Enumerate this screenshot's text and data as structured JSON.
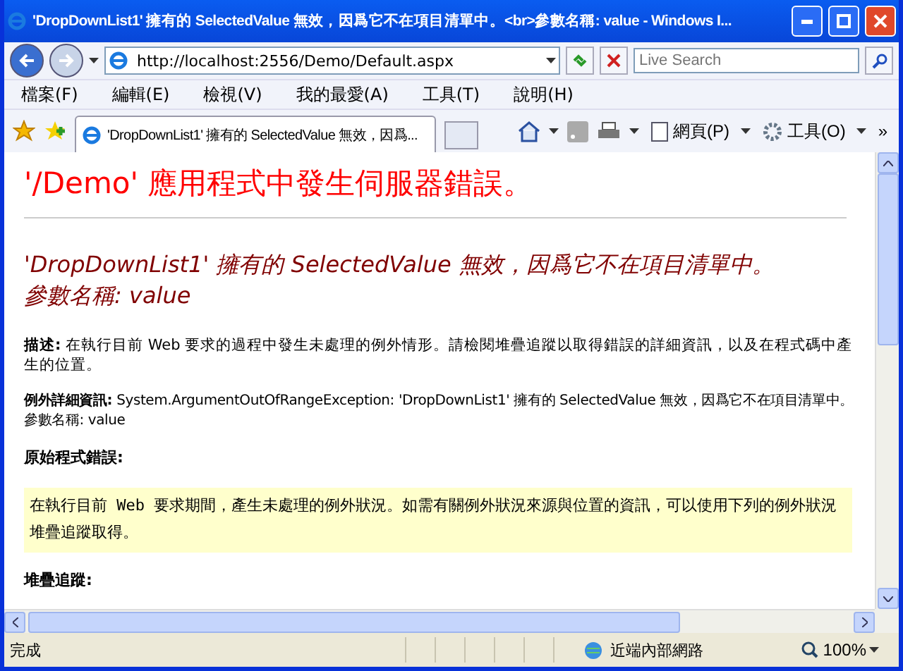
{
  "window": {
    "title": "'DropDownList1' 擁有的 SelectedValue 無效，因爲它不在項目清單中。<br>參數名稱: value - Windows I..."
  },
  "address_bar": {
    "value": "http://localhost:2556/Demo/Default.aspx"
  },
  "search": {
    "placeholder": "Live Search"
  },
  "menu": [
    "檔案(F)",
    "編輯(E)",
    "檢視(V)",
    "我的最愛(A)",
    "工具(T)",
    "說明(H)"
  ],
  "tabs": [
    {
      "label": "'DropDownList1' 擁有的 SelectedValue 無效，因爲...",
      "selected": true
    }
  ],
  "command_bar": {
    "page": "網頁(P)",
    "tools": "工具(O)",
    "more": "»"
  },
  "content": {
    "heading": "'/Demo' 應用程式中發生伺服器錯誤。",
    "error_lines": [
      "'DropDownList1' 擁有的 SelectedValue 無效，因爲它不在項目清單中。",
      "參數名稱: value"
    ],
    "description": "**描述:** 在執行目前 Web 要求的過程中發生未處理的例外情形。請檢閱堆疊追蹤以取得錯誤的詳細資訊，以及在程式碼中產生的位置。",
    "exception_details": [
      "**例外詳細資訊:** System.ArgumentOutOfRangeException: 'DropDownList1' 擁有的 SelectedValue 無效，因爲它不在項目清單中。",
      "參數名稱: value"
    ],
    "source_error_heading": "原始程式錯誤:",
    "source_error_box": "在執行目前 Web 要求期間，產生未處理的例外狀況。如需有關例外狀況來源與位置的資訊，可以使用下列的例外狀況堆疊追蹤取得。",
    "stack_trace_heading": "堆疊追蹤:"
  },
  "status_bar": {
    "text": "完成",
    "zone": "近端內部網路",
    "zoom": "100%"
  }
}
